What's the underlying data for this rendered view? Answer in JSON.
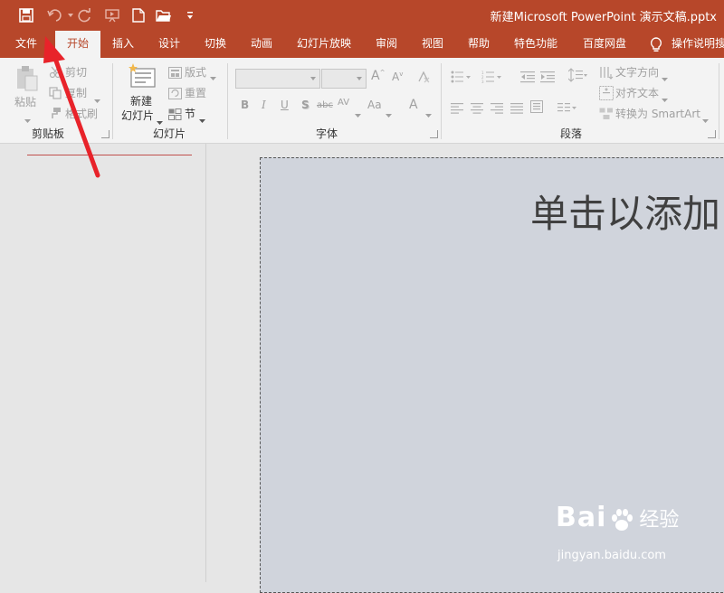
{
  "title_bar": {
    "document_title": "新建Microsoft PowerPoint 演示文稿.pptx",
    "quick_access": [
      "save-icon",
      "undo-icon",
      "redo-icon",
      "start-from-beginning-icon",
      "new-icon",
      "open-icon",
      "customize-icon"
    ]
  },
  "tabs": [
    "文件",
    "开始",
    "插入",
    "设计",
    "切换",
    "动画",
    "幻灯片放映",
    "审阅",
    "视图",
    "帮助",
    "特色功能",
    "百度网盘",
    "操作说明搜"
  ],
  "active_tab": "开始",
  "ribbon": {
    "clipboard": {
      "paste": "粘贴",
      "cut": "剪切",
      "copy": "复制",
      "format_painter": "格式刷",
      "label": "剪贴板"
    },
    "slides": {
      "new_slide": "新建",
      "new_slide_line2": "幻灯片",
      "layout": "版式",
      "reset": "重置",
      "section": "节",
      "label": "幻灯片"
    },
    "font": {
      "bold": "B",
      "italic": "I",
      "underline": "U",
      "shadow": "S",
      "strike": "abc",
      "spacing": "AV",
      "case": "Aa",
      "color": "A",
      "label": "字体"
    },
    "paragraph": {
      "text_direction": "文字方向",
      "align_text": "对齐文本",
      "smartart": "转换为 SmartArt",
      "label": "段落"
    }
  },
  "slide": {
    "title_placeholder": "单击以添加"
  },
  "watermark": {
    "brand": "Bai",
    "brand2": "du",
    "product": "经验",
    "url": "jingyan.baidu.com"
  },
  "colors": {
    "accent": "#b7472a",
    "annotation_arrow": "#e8232a"
  }
}
